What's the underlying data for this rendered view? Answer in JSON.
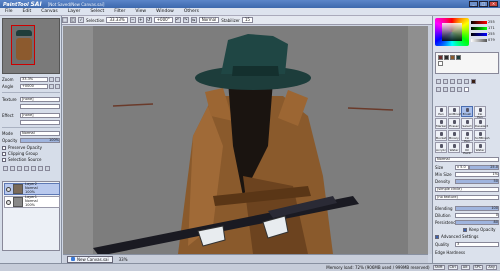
{
  "app": {
    "logo_small": "PaintTool",
    "logo_big": "SAI",
    "document_title": "[Not Saved/New Canvas.sai]"
  },
  "window_buttons": [
    "_",
    "□",
    "×"
  ],
  "menu": [
    "File",
    "Edit",
    "Canvas",
    "Layer",
    "Select",
    "Filter",
    "View",
    "Window",
    "Others"
  ],
  "toolbar": {
    "selection_label": "Selection",
    "zoom": "33.33%",
    "angle": "+000°",
    "blend_mode": "Normal",
    "stabilizer_label": "Stabilizer",
    "stabilizer_value": "15"
  },
  "left": {
    "zoom_label": "Zoom",
    "zoom_value": "33.3%",
    "angle_label": "Angle",
    "angle_value": "+0000",
    "texture_label": "Texture",
    "texture_value": "[none]",
    "effect_label": "Effect",
    "effect_value": "[none]",
    "mode_label": "Mode",
    "mode_value": "Normal",
    "opacity_label": "Opacity",
    "opacity_value": "100%",
    "checks": [
      "Preserve Opacity",
      "Clipping Group",
      "Selection Source"
    ],
    "layers": [
      {
        "name": "Layer2",
        "mode": "Normal",
        "opacity": "100%",
        "selected": true
      },
      {
        "name": "Layer1",
        "mode": "Normal",
        "opacity": "100%",
        "selected": false
      }
    ]
  },
  "tab": {
    "name": "New Canvas.sai",
    "zoom": "33%"
  },
  "right": {
    "sliders": [
      "255",
      "171",
      "255",
      "079"
    ],
    "tools": [
      [
        "Pen",
        "AirBrush",
        "Brush",
        "Ink Pen"
      ],
      [
        "Marker",
        "Eraser",
        "Select",
        "Deselect"
      ],
      [
        "Bucket",
        "Binary",
        "Ink Pen",
        "SoftBrush"
      ],
      [
        "Acrylic",
        "Water",
        "Oil Paint",
        "Water"
      ]
    ],
    "brush_mode": "Normal",
    "size_label": "Size",
    "size_mult": "x 5.0",
    "size_value": "25.0",
    "min_size_label": "Min Size",
    "min_size_value": "1%",
    "density_label": "Density",
    "density_value": "50",
    "shape": "(simple circle)",
    "texture": "(no texture)",
    "blending_label": "Blending",
    "blending_value": "100",
    "dilution_label": "Dilution",
    "dilution_value": "0",
    "persistence_label": "Persistence",
    "persistence_value": "80",
    "keep_opacity": "Keep Opacity",
    "advanced": "Advanced Settings",
    "quality_label": "Quality",
    "quality_value": "3",
    "edge_label": "Edge Hardness"
  },
  "status": {
    "memory": "Memory load: 72% (906MB used / 999MB reserved)",
    "indicators": [
      "Shift",
      "Ctrl",
      "Alt",
      "SPC",
      "Any"
    ]
  },
  "colors": {
    "hat": "#1d3d3b",
    "coat": "#8a5a2c",
    "background": "#7d7d7d"
  }
}
